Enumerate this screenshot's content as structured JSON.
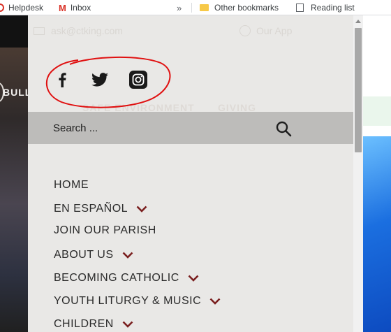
{
  "bookmarks": {
    "helpdesk": "Helpdesk",
    "inbox": "Inbox",
    "more": "»",
    "other": "Other bookmarks",
    "reading": "Reading list"
  },
  "background_nav": {
    "item1": "BULLETINS",
    "item2": "SAFE ENVIRONMENT",
    "item3": "GIVING"
  },
  "topbar": {
    "email": "ask@ctking.com",
    "app": "Our App"
  },
  "social": {
    "icons": [
      "facebook-icon",
      "twitter-icon",
      "instagram-icon"
    ]
  },
  "search": {
    "placeholder": "Search ..."
  },
  "menu": {
    "items": [
      {
        "label": "HOME"
      },
      {
        "label": "EN ESPAÑOL"
      },
      {
        "label": "JOIN OUR PARISH"
      },
      {
        "label": "ABOUT US"
      },
      {
        "label": "BECOMING CATHOLIC"
      },
      {
        "label": "YOUTH LITURGY & MUSIC"
      },
      {
        "label": "CHILDREN"
      }
    ]
  },
  "colors": {
    "accent": "#7a1f1f",
    "annotation": "#e01010",
    "panel": "#e9e8e6",
    "search_bar": "#bdbcba"
  }
}
